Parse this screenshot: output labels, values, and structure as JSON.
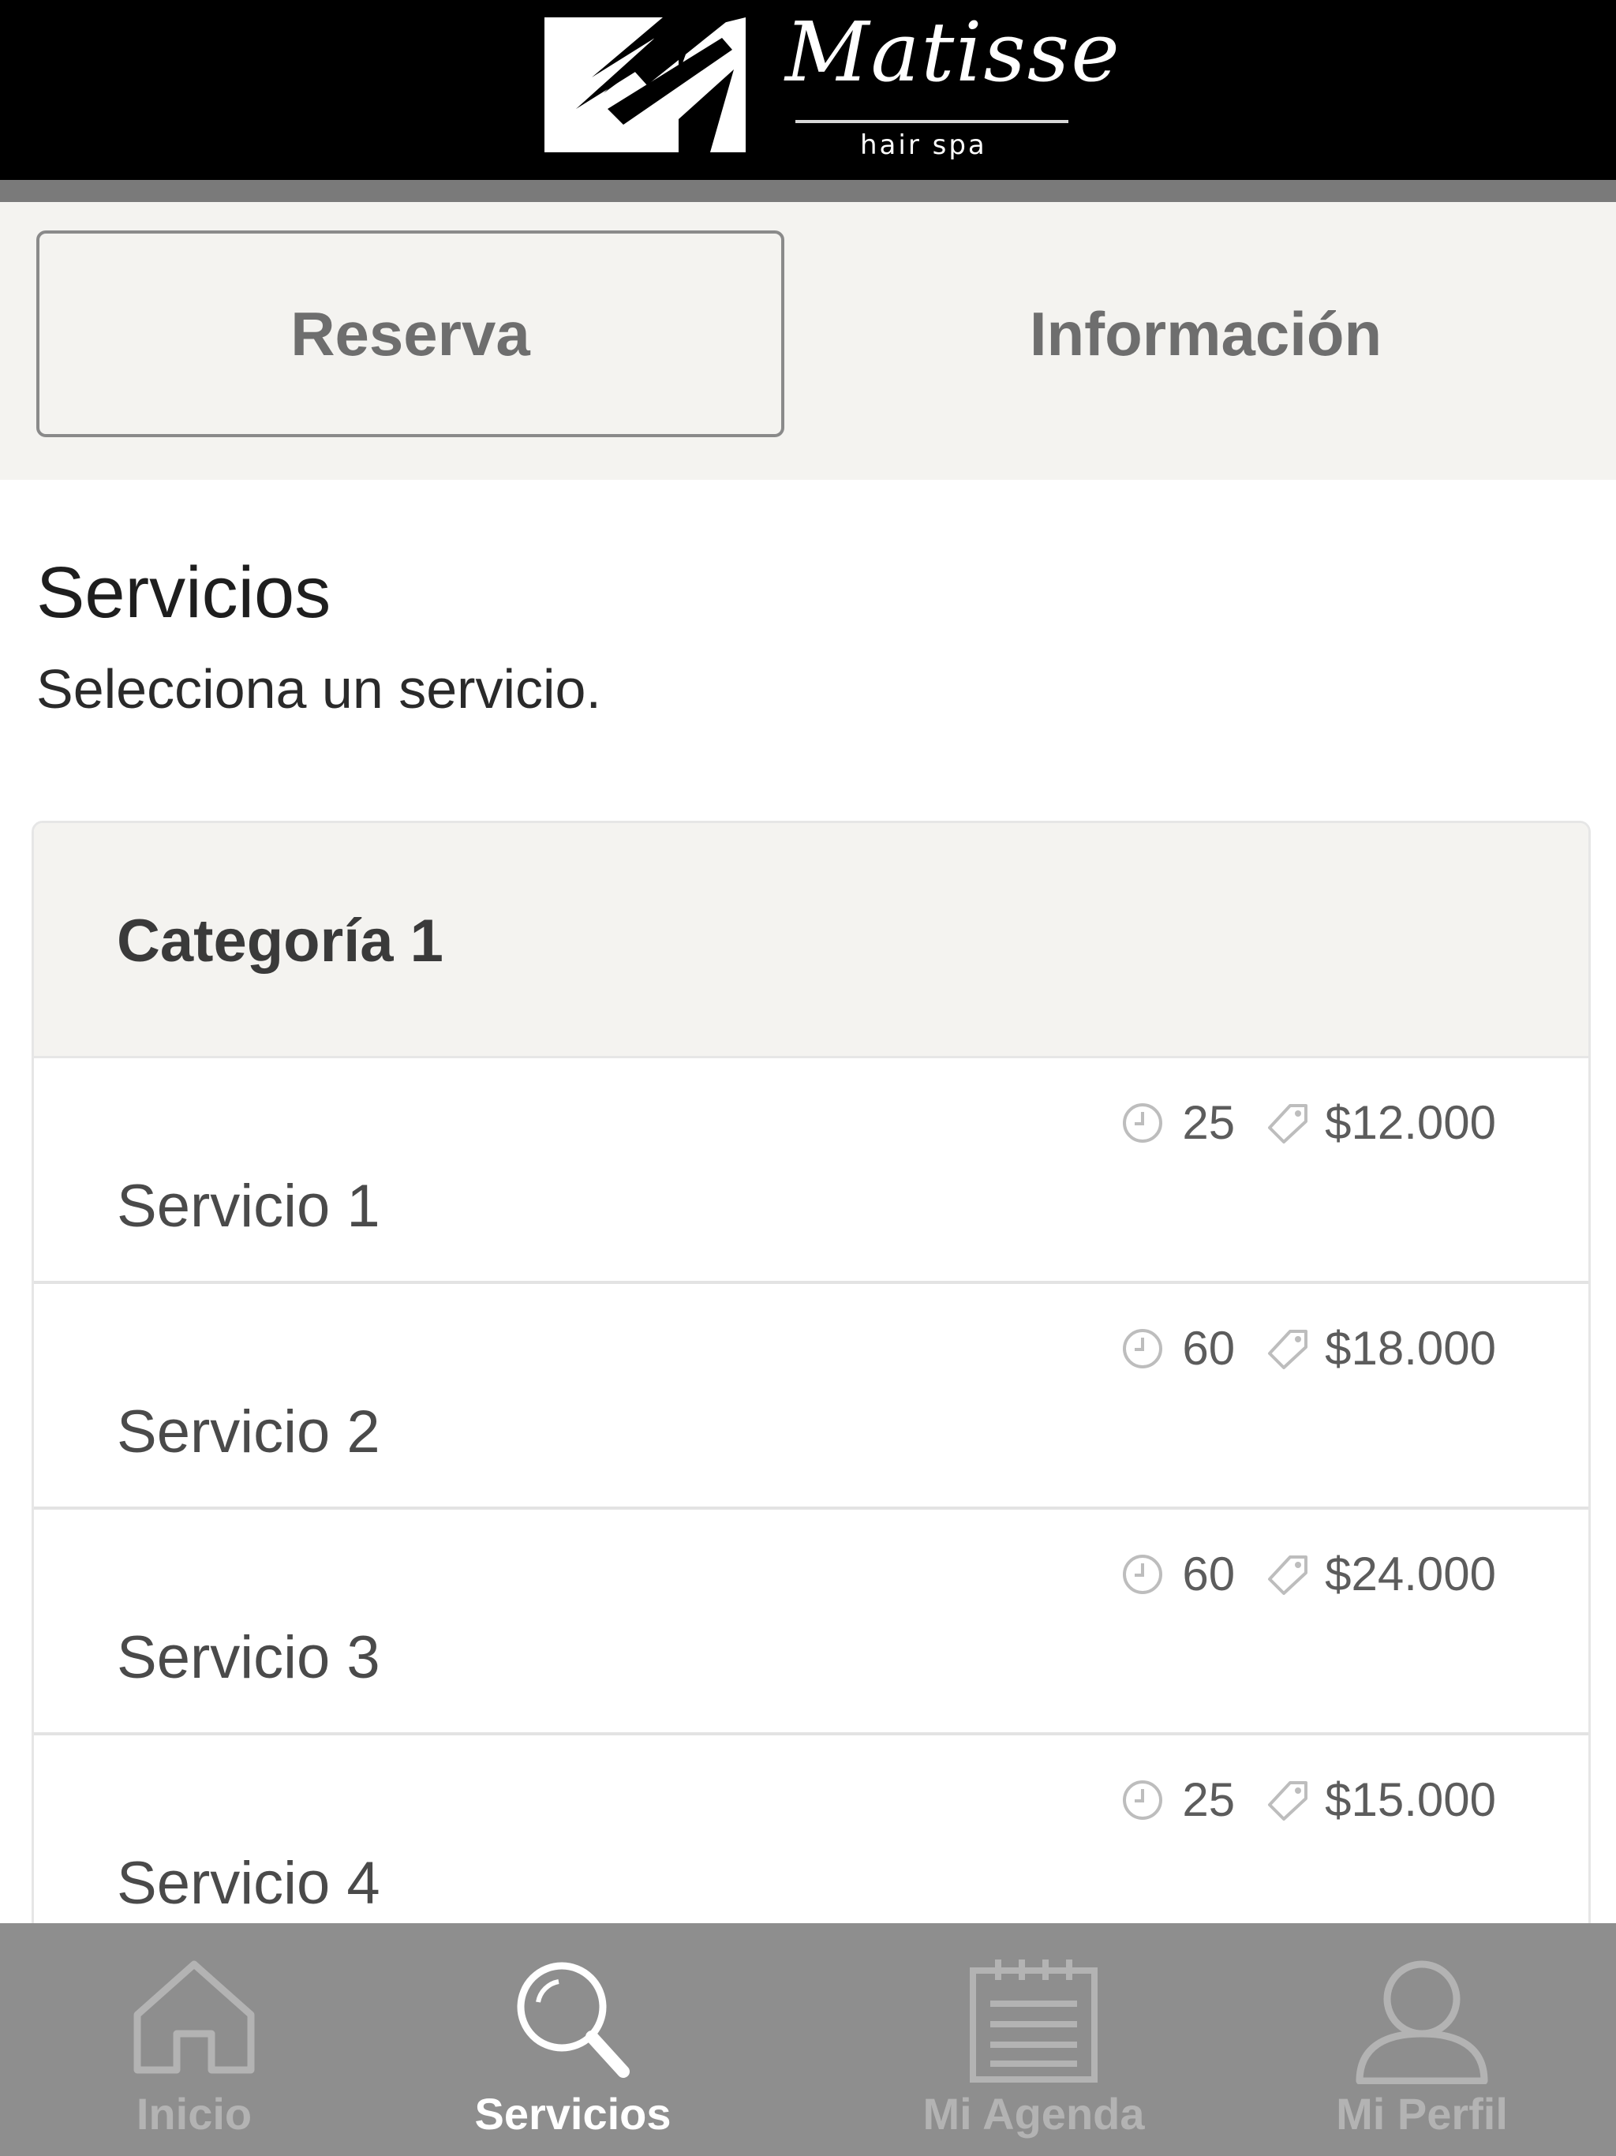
{
  "header": {
    "brand_name": "Matisse",
    "brand_tagline": "hair spa"
  },
  "tabs": [
    {
      "label": "Reserva",
      "active": true
    },
    {
      "label": "Información",
      "active": false
    }
  ],
  "section": {
    "title": "Servicios",
    "subtitle": "Selecciona un servicio."
  },
  "category": {
    "title": "Categoría 1",
    "services": [
      {
        "name": "Servicio 1",
        "duration": "25",
        "price": "$12.000"
      },
      {
        "name": "Servicio 2",
        "duration": "60",
        "price": "$18.000"
      },
      {
        "name": "Servicio 3",
        "duration": "60",
        "price": "$24.000"
      },
      {
        "name": "Servicio 4",
        "duration": "25",
        "price": "$15.000"
      }
    ]
  },
  "icons": {
    "duration": "clock-icon",
    "price": "tag-icon"
  },
  "bottom_nav": [
    {
      "label": "Inicio",
      "icon": "home-icon",
      "active": false
    },
    {
      "label": "Servicios",
      "icon": "search-icon",
      "active": true
    },
    {
      "label": "Mi Agenda",
      "icon": "calendar-icon",
      "active": false
    },
    {
      "label": "Mi Perfil",
      "icon": "user-icon",
      "active": false
    }
  ],
  "colors": {
    "header_bg": "#000000",
    "tab_bar_bg": "#f4f3f0",
    "nav_bg": "#8e8e8e",
    "nav_active_text": "#ffffff",
    "nav_inactive_text": "#b3b3b3"
  }
}
